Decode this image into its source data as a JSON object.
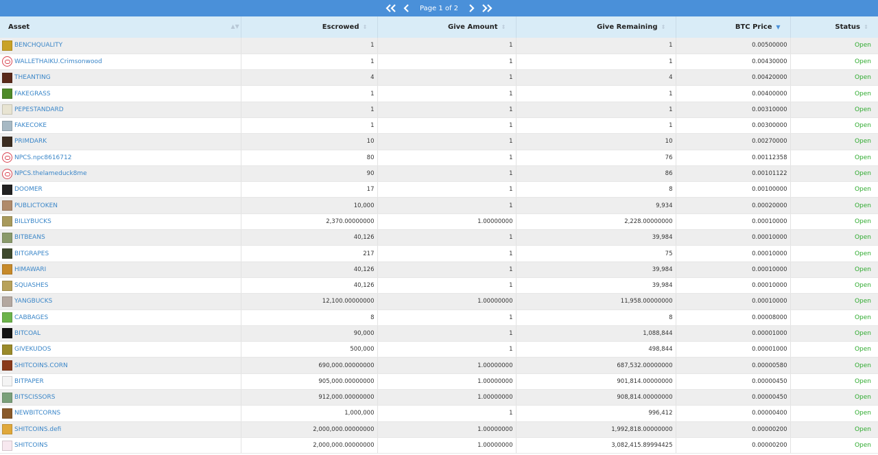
{
  "pager": {
    "text": "Page 1 of 2"
  },
  "columns": [
    {
      "label": "Asset",
      "align": "left"
    },
    {
      "label": "Escrowed",
      "align": "right"
    },
    {
      "label": "Give Amount",
      "align": "right"
    },
    {
      "label": "Give Remaining",
      "align": "right"
    },
    {
      "label": "BTC Price",
      "align": "right",
      "sorted": "desc"
    },
    {
      "label": "Status",
      "align": "right"
    }
  ],
  "colors": {
    "header_bar": "#4a90d9",
    "table_header": "#d9ecf7",
    "link": "#3a86c8",
    "status_open": "#2eaa2e"
  },
  "rows": [
    {
      "asset": "BENCHQUALITY",
      "icon": "#c9a227",
      "escrowed": "1",
      "give_amount": "1",
      "give_remaining": "1",
      "btc_price": "0.00500000",
      "status": "Open"
    },
    {
      "asset": "WALLETHAIKU.Crimsonwood",
      "icon": "round",
      "escrowed": "1",
      "give_amount": "1",
      "give_remaining": "1",
      "btc_price": "0.00430000",
      "status": "Open"
    },
    {
      "asset": "THEANTING",
      "icon": "#5a2a1a",
      "escrowed": "4",
      "give_amount": "1",
      "give_remaining": "4",
      "btc_price": "0.00420000",
      "status": "Open"
    },
    {
      "asset": "FAKEGRASS",
      "icon": "#4f8a2a",
      "escrowed": "1",
      "give_amount": "1",
      "give_remaining": "1",
      "btc_price": "0.00400000",
      "status": "Open"
    },
    {
      "asset": "PEPESTANDARD",
      "icon": "#e8e4d2",
      "escrowed": "1",
      "give_amount": "1",
      "give_remaining": "1",
      "btc_price": "0.00310000",
      "status": "Open"
    },
    {
      "asset": "FAKECOKE",
      "icon": "#a7b9c4",
      "escrowed": "1",
      "give_amount": "1",
      "give_remaining": "1",
      "btc_price": "0.00300000",
      "status": "Open"
    },
    {
      "asset": "PRIMDARK",
      "icon": "#3b2c20",
      "escrowed": "10",
      "give_amount": "1",
      "give_remaining": "10",
      "btc_price": "0.00270000",
      "status": "Open"
    },
    {
      "asset": "NPCS.npc8616712",
      "icon": "round",
      "escrowed": "80",
      "give_amount": "1",
      "give_remaining": "76",
      "btc_price": "0.00112358",
      "status": "Open"
    },
    {
      "asset": "NPCS.thelameduck8me",
      "icon": "round",
      "escrowed": "90",
      "give_amount": "1",
      "give_remaining": "86",
      "btc_price": "0.00101122",
      "status": "Open"
    },
    {
      "asset": "DOOMER",
      "icon": "#222222",
      "escrowed": "17",
      "give_amount": "1",
      "give_remaining": "8",
      "btc_price": "0.00100000",
      "status": "Open"
    },
    {
      "asset": "PUBLICTOKEN",
      "icon": "#b08a6a",
      "escrowed": "10,000",
      "give_amount": "1",
      "give_remaining": "9,934",
      "btc_price": "0.00020000",
      "status": "Open"
    },
    {
      "asset": "BILLYBUCKS",
      "icon": "#a89a5c",
      "escrowed": "2,370.00000000",
      "give_amount": "1.00000000",
      "give_remaining": "2,228.00000000",
      "btc_price": "0.00010000",
      "status": "Open"
    },
    {
      "asset": "BITBEANS",
      "icon": "#8a9a6a",
      "escrowed": "40,126",
      "give_amount": "1",
      "give_remaining": "39,984",
      "btc_price": "0.00010000",
      "status": "Open"
    },
    {
      "asset": "BITGRAPES",
      "icon": "#3f4a2e",
      "escrowed": "217",
      "give_amount": "1",
      "give_remaining": "75",
      "btc_price": "0.00010000",
      "status": "Open"
    },
    {
      "asset": "HIMAWARI",
      "icon": "#c78a2a",
      "escrowed": "40,126",
      "give_amount": "1",
      "give_remaining": "39,984",
      "btc_price": "0.00010000",
      "status": "Open"
    },
    {
      "asset": "SQUASHES",
      "icon": "#b8a25a",
      "escrowed": "40,126",
      "give_amount": "1",
      "give_remaining": "39,984",
      "btc_price": "0.00010000",
      "status": "Open"
    },
    {
      "asset": "YANGBUCKS",
      "icon": "#b4a8a0",
      "escrowed": "12,100.00000000",
      "give_amount": "1.00000000",
      "give_remaining": "11,958.00000000",
      "btc_price": "0.00010000",
      "status": "Open"
    },
    {
      "asset": "CABBAGES",
      "icon": "#6cb34a",
      "escrowed": "8",
      "give_amount": "1",
      "give_remaining": "8",
      "btc_price": "0.00008000",
      "status": "Open"
    },
    {
      "asset": "BITCOAL",
      "icon": "#111111",
      "escrowed": "90,000",
      "give_amount": "1",
      "give_remaining": "1,088,844",
      "btc_price": "0.00001000",
      "status": "Open"
    },
    {
      "asset": "GIVEKUDOS",
      "icon": "#9a8a2a",
      "escrowed": "500,000",
      "give_amount": "1",
      "give_remaining": "498,844",
      "btc_price": "0.00001000",
      "status": "Open"
    },
    {
      "asset": "SHITCOINS.CORN",
      "icon": "#8a3a1a",
      "escrowed": "690,000.00000000",
      "give_amount": "1.00000000",
      "give_remaining": "687,532.00000000",
      "btc_price": "0.00000580",
      "status": "Open"
    },
    {
      "asset": "BITPAPER",
      "icon": "#f4f4f4",
      "escrowed": "905,000.00000000",
      "give_amount": "1.00000000",
      "give_remaining": "901,814.00000000",
      "btc_price": "0.00000450",
      "status": "Open"
    },
    {
      "asset": "BITSCISSORS",
      "icon": "#7aa07a",
      "escrowed": "912,000.00000000",
      "give_amount": "1.00000000",
      "give_remaining": "908,814.00000000",
      "btc_price": "0.00000450",
      "status": "Open"
    },
    {
      "asset": "NEWBITCORNS",
      "icon": "#8a5a2a",
      "escrowed": "1,000,000",
      "give_amount": "1",
      "give_remaining": "996,412",
      "btc_price": "0.00000400",
      "status": "Open"
    },
    {
      "asset": "SHITCOINS.defi",
      "icon": "#e0a83a",
      "escrowed": "2,000,000.00000000",
      "give_amount": "1.00000000",
      "give_remaining": "1,992,818.00000000",
      "btc_price": "0.00000200",
      "status": "Open"
    },
    {
      "asset": "SHITCOINS",
      "icon": "#f7e8ef",
      "escrowed": "2,000,000.00000000",
      "give_amount": "1.00000000",
      "give_remaining": "3,082,415.89994425",
      "btc_price": "0.00000200",
      "status": "Open"
    }
  ]
}
